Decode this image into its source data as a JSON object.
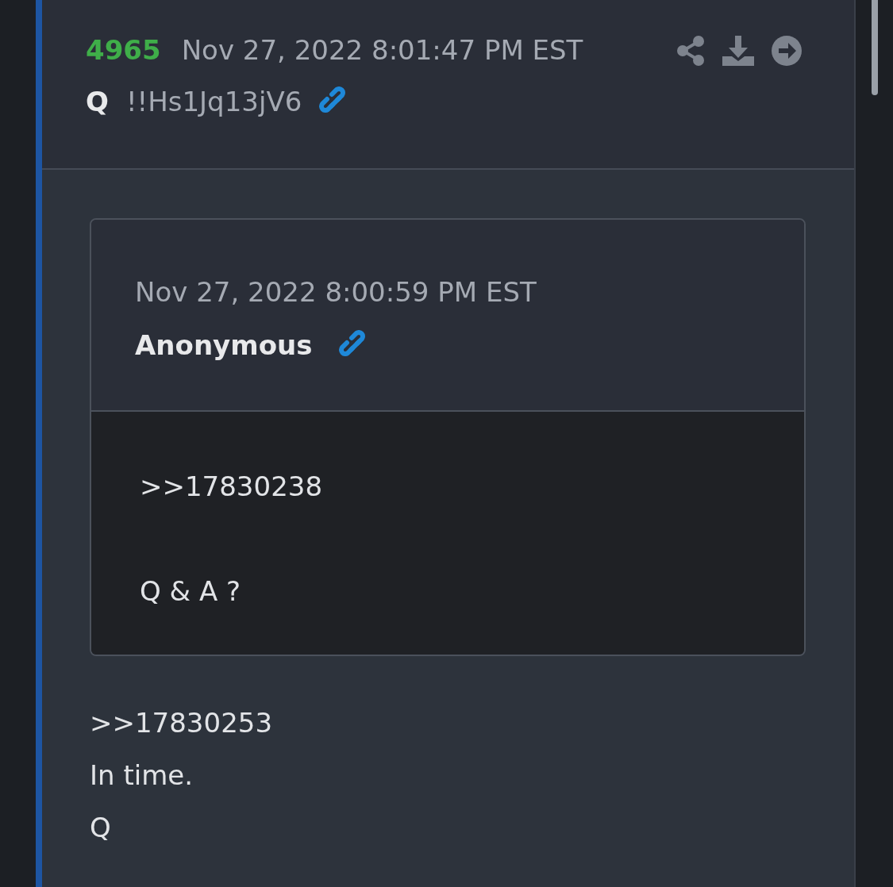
{
  "post": {
    "number": "4965",
    "timestamp": "Nov 27, 2022 8:01:47 PM EST",
    "author": "Q",
    "tripcode": "!!Hs1Jq13jV6"
  },
  "quoted_post": {
    "timestamp": "Nov 27, 2022 8:00:59 PM EST",
    "author": "Anonymous",
    "lines": [
      ">>17830238",
      "Q & A ?"
    ]
  },
  "body_lines": [
    ">>17830253",
    "In time.",
    "Q"
  ]
}
